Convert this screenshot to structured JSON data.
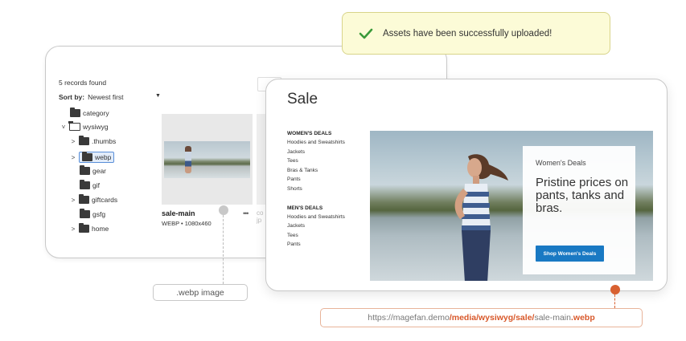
{
  "toast": {
    "message": "Assets have been successfully uploaded!",
    "status_color": "#3a9a3a"
  },
  "gallery": {
    "records_found": "5 records found",
    "sort_label": "Sort by:",
    "sort_value": "Newest first",
    "tree": [
      {
        "label": "category",
        "depth": 1,
        "arrow": "",
        "type": "folder"
      },
      {
        "label": "wysiwyg",
        "depth": 0,
        "arrow": "˅",
        "type": "folder-open"
      },
      {
        "label": ".thumbs",
        "depth": 1,
        "arrow": ">",
        "type": "folder"
      },
      {
        "label": "webp",
        "depth": 1,
        "arrow": ">",
        "type": "folder",
        "selected": true
      },
      {
        "label": "gear",
        "depth": 1,
        "arrow": "",
        "type": "folder"
      },
      {
        "label": "gif",
        "depth": 1,
        "arrow": "",
        "type": "folder"
      },
      {
        "label": "giftcards",
        "depth": 1,
        "arrow": ">",
        "type": "folder"
      },
      {
        "label": "gsfg",
        "depth": 1,
        "arrow": "",
        "type": "folder"
      },
      {
        "label": "home",
        "depth": 1,
        "arrow": ">",
        "type": "folder"
      }
    ],
    "file": {
      "name": "sale-main",
      "meta": "WEBP • 1080x460",
      "more": "•••"
    },
    "second_file_partial": "co",
    "second_file_partial_meta": "jp",
    "callout_label": ".webp image"
  },
  "sale_page": {
    "title": "Sale",
    "womens_heading": "WOMEN'S DEALS",
    "womens_items": [
      "Hoodies and Sweatshirts",
      "Jackets",
      "Tees",
      "Bras & Tanks",
      "Pants",
      "Shorts"
    ],
    "mens_heading": "MEN'S DEALS",
    "mens_items": [
      "Hoodies and Sweatshirts",
      "Jackets",
      "Tees",
      "Pants"
    ],
    "promo_kicker": "Women's Deals",
    "promo_headline": "Pristine prices on pants, tanks and bras.",
    "promo_button": "Shop Women's Deals",
    "button_color": "#1979c3"
  },
  "url": {
    "prefix": "https://magefan.demo",
    "path": "/media/wysiwyg/sale/",
    "filename": "sale-main",
    "extension": ".webp",
    "accent_color": "#d8582a"
  }
}
